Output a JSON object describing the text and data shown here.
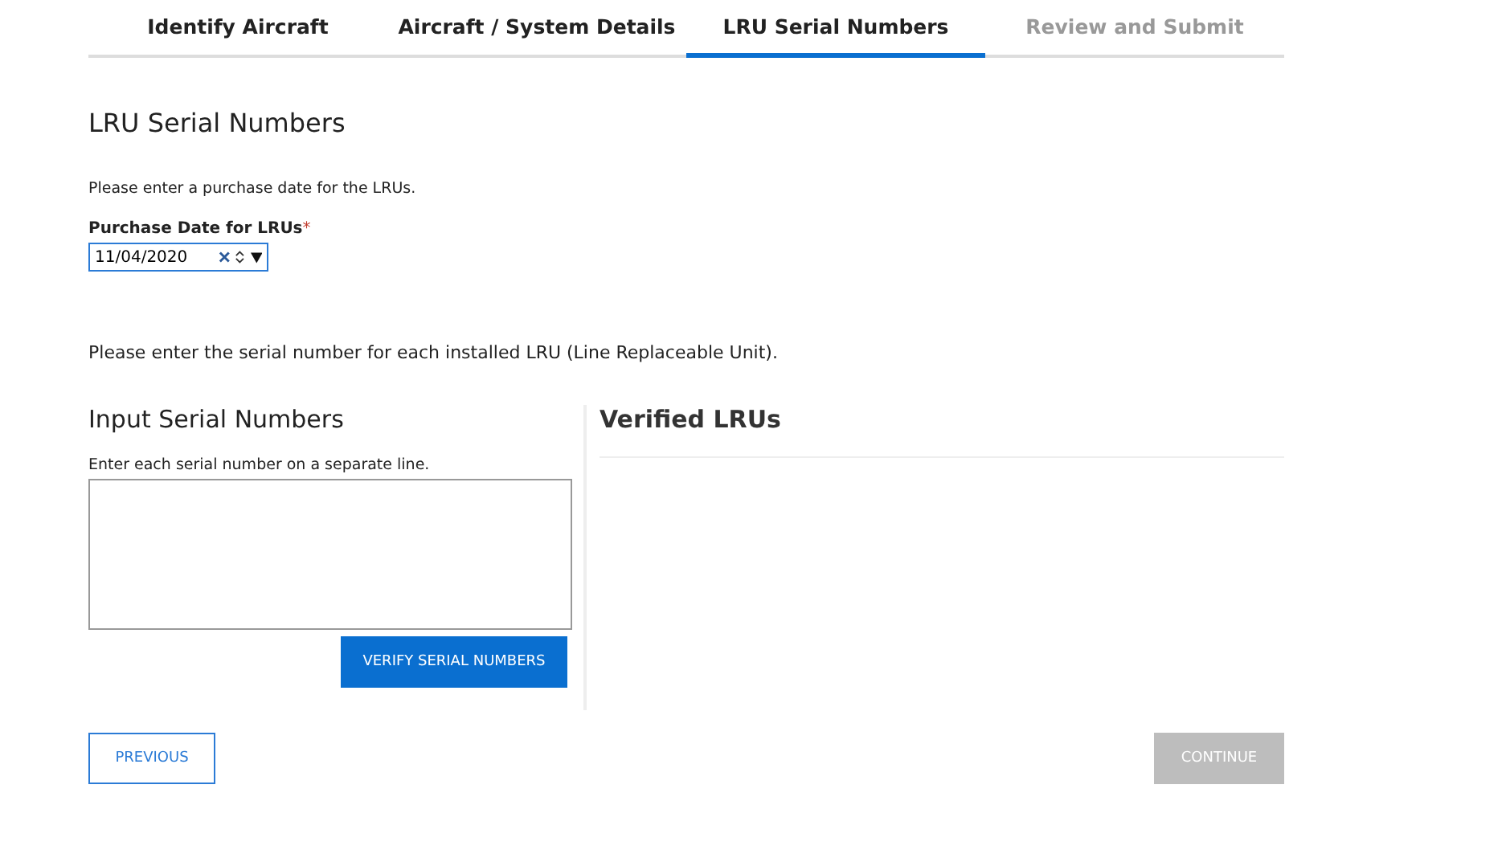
{
  "tabs": [
    {
      "label": "Identify Aircraft",
      "selected": false,
      "disabled": false
    },
    {
      "label": "Aircraft / System Details",
      "selected": false,
      "disabled": false
    },
    {
      "label": "LRU Serial Numbers",
      "selected": true,
      "disabled": false
    },
    {
      "label": "Review and Submit",
      "selected": false,
      "disabled": true
    }
  ],
  "heading": "LRU Serial Numbers",
  "date_intro": "Please enter a purchase date for the LRUs.",
  "date_field": {
    "label": "Purchase Date for LRUs",
    "required_mark": "*",
    "value": "11/04/2020"
  },
  "serial_intro": "Please enter the serial number for each installed LRU (Line Replaceable Unit).",
  "input_panel": {
    "title": "Input Serial Numbers",
    "hint": "Enter each serial number on a separate line.",
    "button": "VERIFY SERIAL NUMBERS"
  },
  "verified_panel": {
    "title": "Verified LRUs"
  },
  "buttons": [
    {
      "label": "PREVIOUS",
      "kind": "secondary",
      "disabled": false
    },
    {
      "label": "CONTINUE",
      "kind": "primary",
      "disabled": true
    }
  ]
}
